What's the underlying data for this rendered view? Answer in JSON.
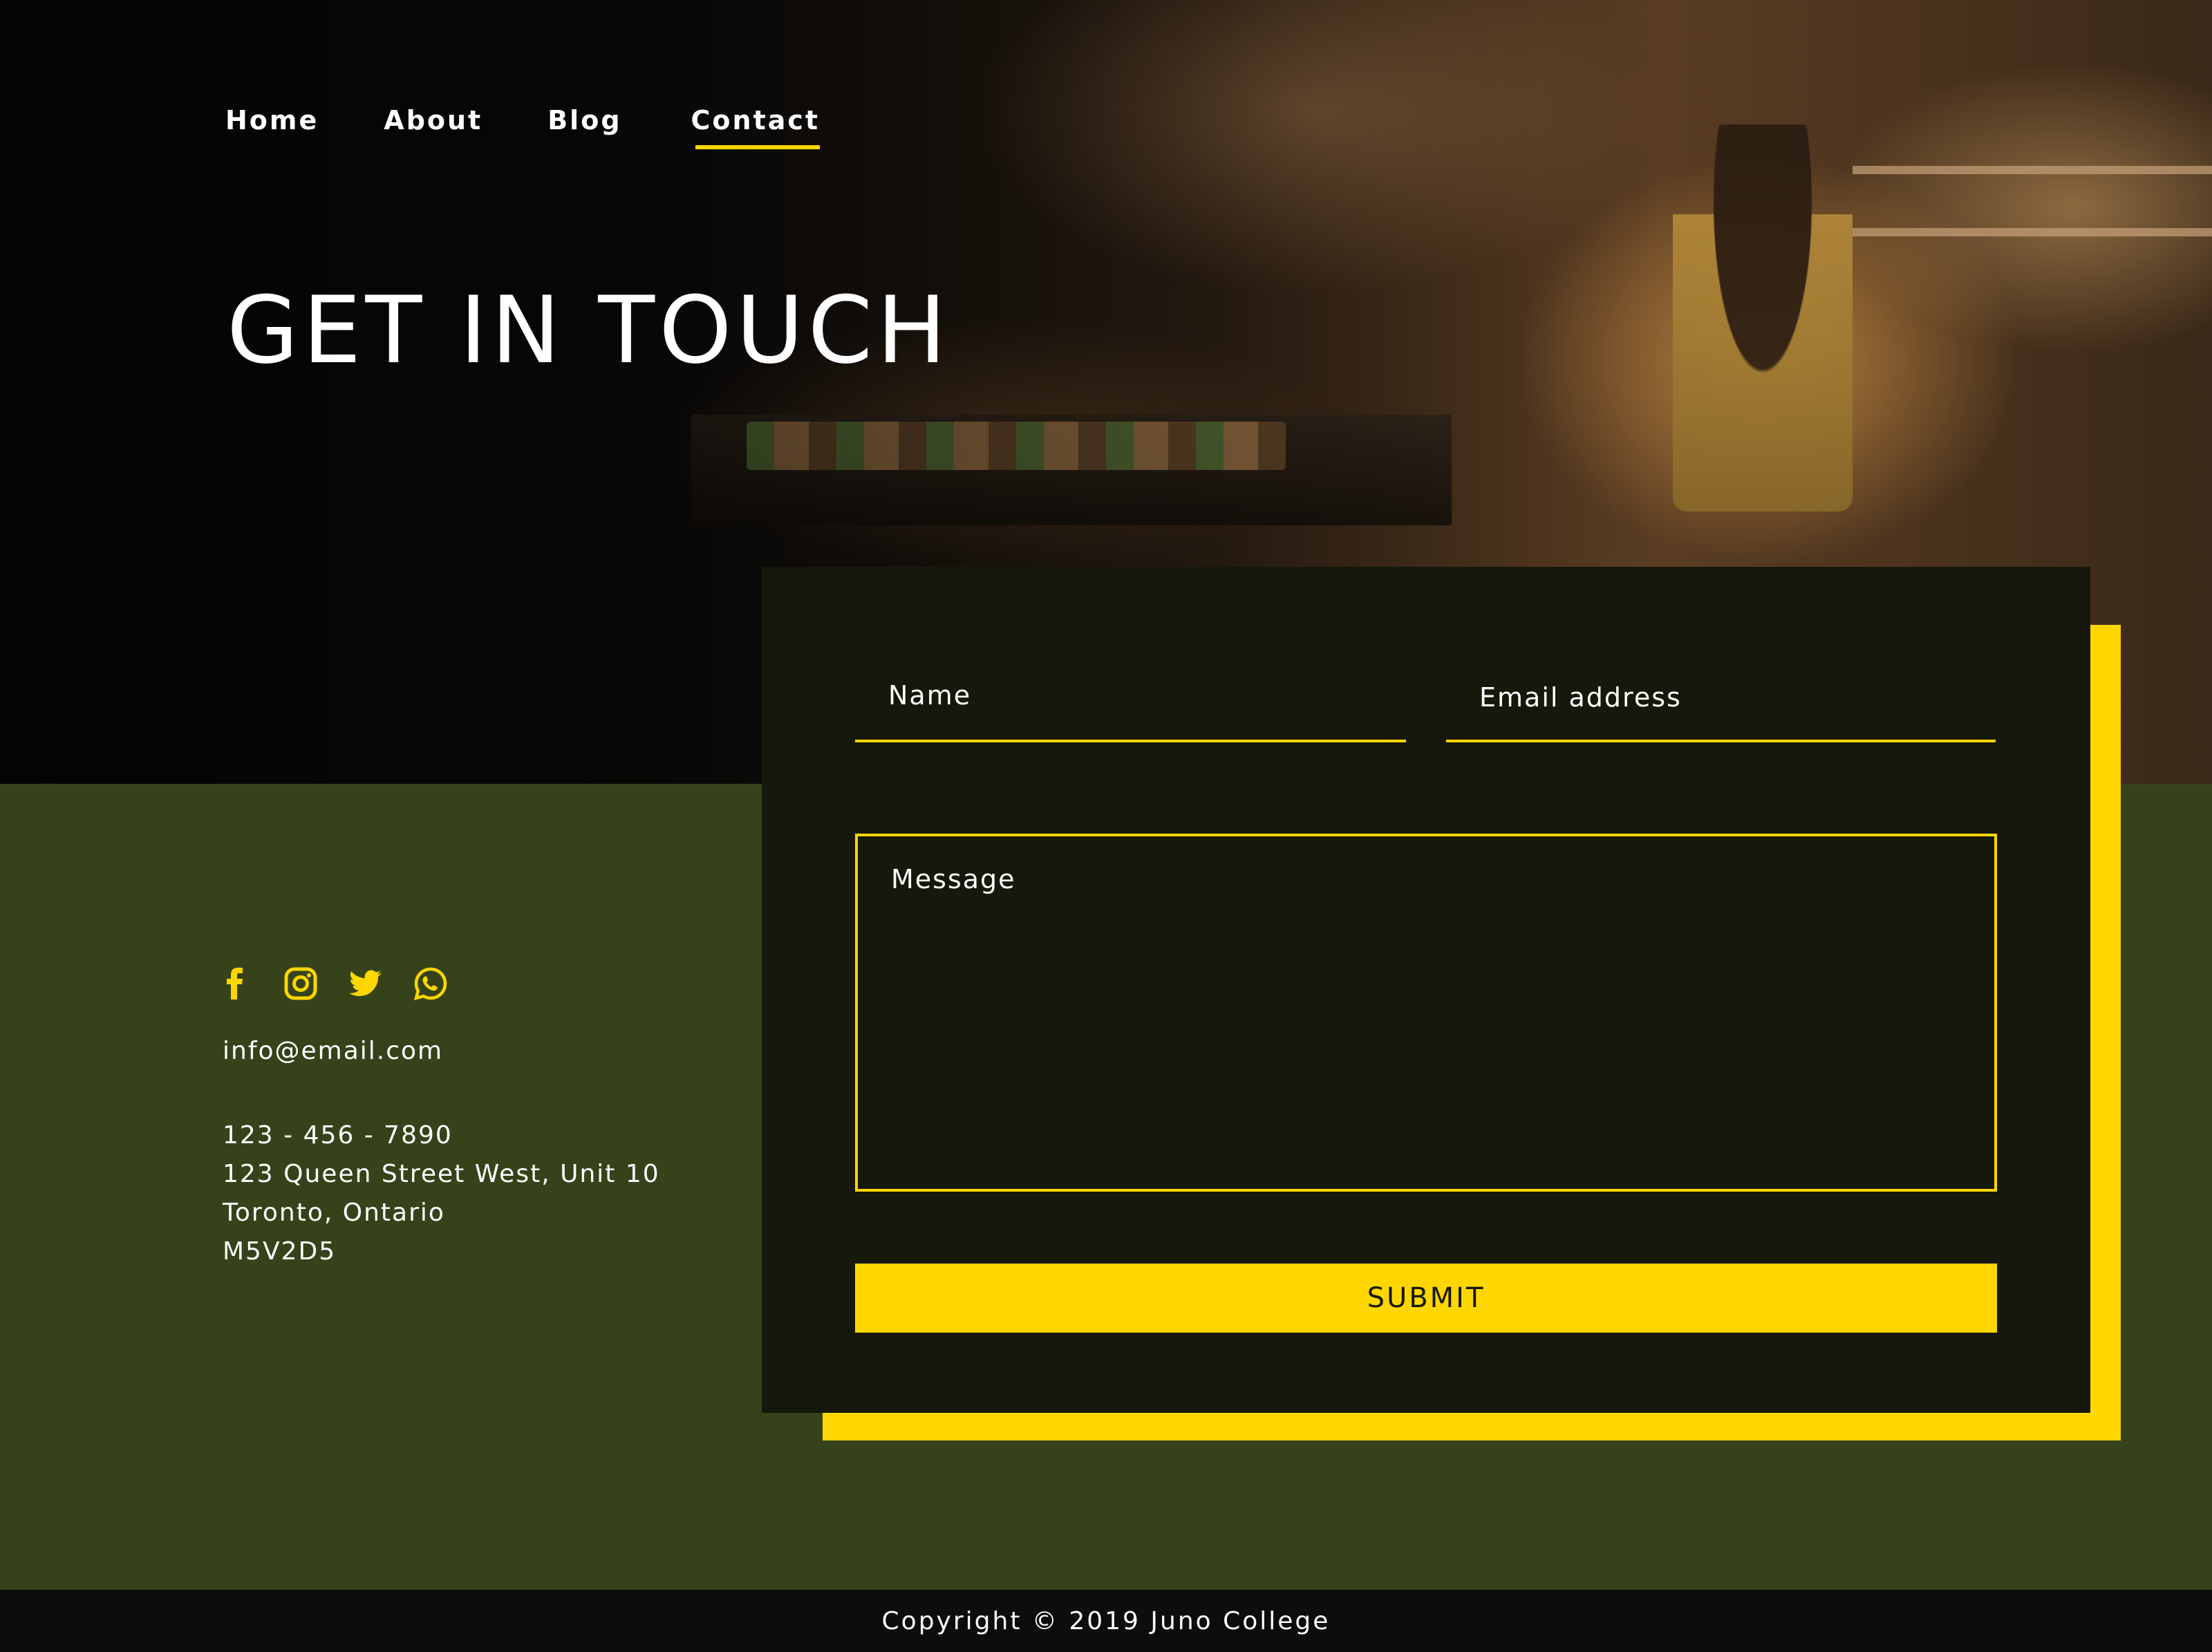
{
  "nav": {
    "items": [
      {
        "label": "Home",
        "active": false
      },
      {
        "label": "About",
        "active": false
      },
      {
        "label": "Blog",
        "active": false
      },
      {
        "label": "Contact",
        "active": true
      }
    ]
  },
  "hero": {
    "title": "GET IN TOUCH",
    "background": "kitchen-photo"
  },
  "contact": {
    "social": [
      "facebook-icon",
      "instagram-icon",
      "twitter-icon",
      "whatsapp-icon"
    ],
    "email": "info@email.com",
    "phone": "123 - 456 - 7890",
    "address_line1": "123 Queen Street West, Unit 10",
    "address_line2": "Toronto, Ontario",
    "postal_code": "M5V2D5"
  },
  "form": {
    "name_placeholder": "Name",
    "email_placeholder": "Email address",
    "message_placeholder": "Message",
    "submit_label": "SUBMIT"
  },
  "footer": {
    "copyright": "Copyright © 2019 Juno College"
  },
  "colors": {
    "accent": "#ffd600",
    "page_background": "#36431a",
    "card_background": "#15180b",
    "footer_background": "#0d0d0c"
  }
}
